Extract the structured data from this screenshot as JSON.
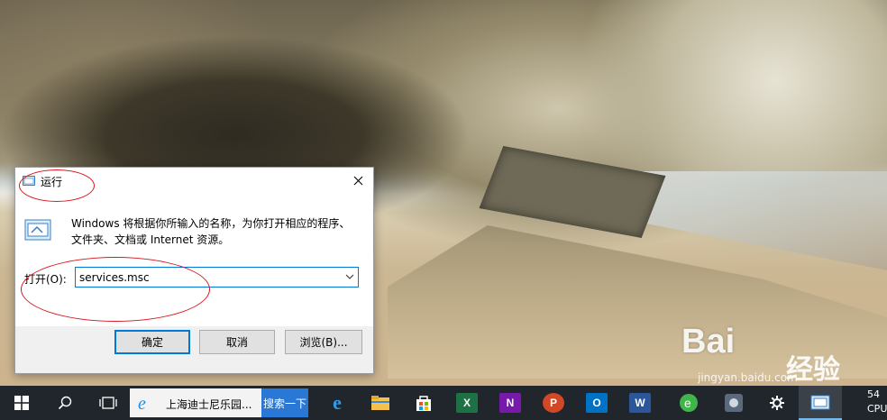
{
  "dialog": {
    "title": "运行",
    "description_line1": "Windows 将根据你所输入的名称，为你打开相应的程序、",
    "description_line2": "文件夹、文档或 Internet 资源。",
    "open_label": "打开(O):",
    "open_value": "services.msc",
    "ok_label": "确定",
    "cancel_label": "取消",
    "browse_label": "浏览(B)..."
  },
  "taskbar": {
    "search_text": "上海迪士尼乐园...",
    "search_button": "搜索一下",
    "apps": [
      {
        "name": "edge-icon",
        "glyph": "e",
        "color": "#1e90e0"
      },
      {
        "name": "file-explorer-icon",
        "glyph": "",
        "color": "#f2c14e"
      },
      {
        "name": "store-icon",
        "glyph": "",
        "color": "#ffffff"
      },
      {
        "name": "excel-icon",
        "glyph": "X",
        "color": "#1e7145"
      },
      {
        "name": "onenote-icon",
        "glyph": "N",
        "color": "#7719aa"
      },
      {
        "name": "powerpoint-icon",
        "glyph": "P",
        "color": "#d24726"
      },
      {
        "name": "outlook-icon",
        "glyph": "O",
        "color": "#0072c6"
      },
      {
        "name": "word-icon",
        "glyph": "W",
        "color": "#2b579a"
      }
    ],
    "clock_line1": "54",
    "clock_line2": "CPU"
  },
  "watermark": {
    "brand": "Bai",
    "brand_cn": "经验",
    "url": "jingyan.baidu.com"
  },
  "colors": {
    "accent": "#0078d7",
    "annotation": "#d9161d",
    "taskbar": "#20262c"
  }
}
